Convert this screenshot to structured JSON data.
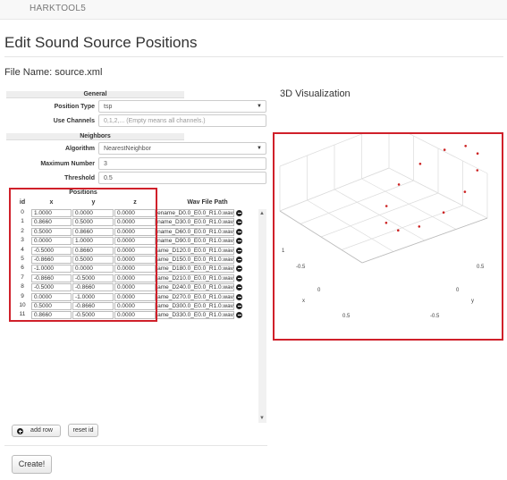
{
  "navbar": {
    "brand": "HARKTOOL5"
  },
  "page": {
    "title": "Edit Sound Source Positions",
    "file_name": "File Name: source.xml",
    "viz_title": "3D Visualization"
  },
  "general": {
    "heading": "General",
    "position_type_label": "Position Type",
    "position_type_value": "tsp",
    "use_channels_label": "Use Channels",
    "use_channels_placeholder": "0,1,2,... (Empty means all channels.)"
  },
  "neighbors": {
    "heading": "Neighbors",
    "algorithm_label": "Algorithm",
    "algorithm_value": "NearestNeighbor",
    "max_number_label": "Maximum Number",
    "max_number_value": "3",
    "threshold_label": "Threshold",
    "threshold_value": "0.5"
  },
  "positions": {
    "heading": "Positions",
    "columns": [
      "id",
      "x",
      "y",
      "z"
    ],
    "wav_header": "Wav File Path",
    "rows": [
      {
        "id": "0",
        "x": "1.0000",
        "y": "0.0000",
        "z": "0.0000",
        "wav": "filename_D0.0_E0.0_R1.0.wav"
      },
      {
        "id": "1",
        "x": "0.8660",
        "y": "0.5000",
        "z": "0.0000",
        "wav": "filename_D30.0_E0.0_R1.0.wav"
      },
      {
        "id": "2",
        "x": "0.5000",
        "y": "0.8660",
        "z": "0.0000",
        "wav": "filename_D60.0_E0.0_R1.0.wav"
      },
      {
        "id": "3",
        "x": "0.0000",
        "y": "1.0000",
        "z": "0.0000",
        "wav": "filename_D90.0_E0.0_R1.0.wav"
      },
      {
        "id": "4",
        "x": "-0.5000",
        "y": "0.8660",
        "z": "0.0000",
        "wav": "filename_D120.0_E0.0_R1.0.wav"
      },
      {
        "id": "5",
        "x": "-0.8660",
        "y": "0.5000",
        "z": "0.0000",
        "wav": "filename_D150.0_E0.0_R1.0.wav"
      },
      {
        "id": "6",
        "x": "-1.0000",
        "y": "0.0000",
        "z": "0.0000",
        "wav": "filename_D180.0_E0.0_R1.0.wav"
      },
      {
        "id": "7",
        "x": "-0.8660",
        "y": "-0.5000",
        "z": "0.0000",
        "wav": "filename_D210.0_E0.0_R1.0.wav"
      },
      {
        "id": "8",
        "x": "-0.5000",
        "y": "-0.8660",
        "z": "0.0000",
        "wav": "filename_D240.0_E0.0_R1.0.wav"
      },
      {
        "id": "9",
        "x": "0.0000",
        "y": "-1.0000",
        "z": "0.0000",
        "wav": "filename_D270.0_E0.0_R1.0.wav"
      },
      {
        "id": "10",
        "x": "0.5000",
        "y": "-0.8660",
        "z": "0.0000",
        "wav": "filename_D300.0_E0.0_R1.0.wav"
      },
      {
        "id": "11",
        "x": "0.8660",
        "y": "-0.5000",
        "z": "0.0000",
        "wav": "filename_D330.0_E0.0_R1.0.wav"
      }
    ]
  },
  "buttons": {
    "add_row": "add row",
    "reset_id": "reset id",
    "create": "Create!"
  },
  "viz": {
    "tick_labels": [
      "1",
      "-0.5",
      "0",
      "x",
      "0.5",
      "0.5",
      "0",
      "y",
      "-0.5"
    ],
    "highlight_color": "#d0202a",
    "point_color": "#cc2222"
  }
}
